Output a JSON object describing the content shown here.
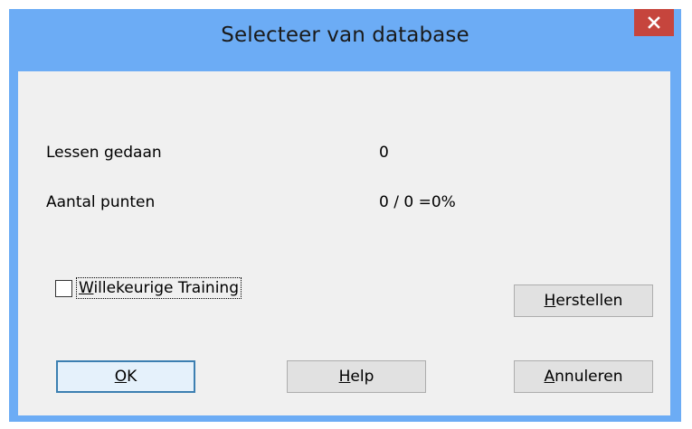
{
  "window": {
    "title": "Selecteer van database",
    "close_icon": "close-icon"
  },
  "stats": {
    "lessons_label": "Lessen gedaan",
    "lessons_value": "0",
    "points_label": "Aantal punten",
    "points_value": "0 / 0 =0%"
  },
  "random_training": {
    "checked": false,
    "label_accel": "W",
    "label_rest": "illekeurige Training"
  },
  "buttons": {
    "reset": {
      "accel": "H",
      "rest": "erstellen"
    },
    "ok": {
      "accel": "O",
      "rest": "K"
    },
    "help": {
      "accel": "H",
      "rest": "elp"
    },
    "cancel": {
      "accel": "A",
      "rest": "nnuleren"
    }
  },
  "colors": {
    "titlebar": "#6cacf5",
    "close_button": "#c6453d",
    "client": "#f0f0f0"
  }
}
